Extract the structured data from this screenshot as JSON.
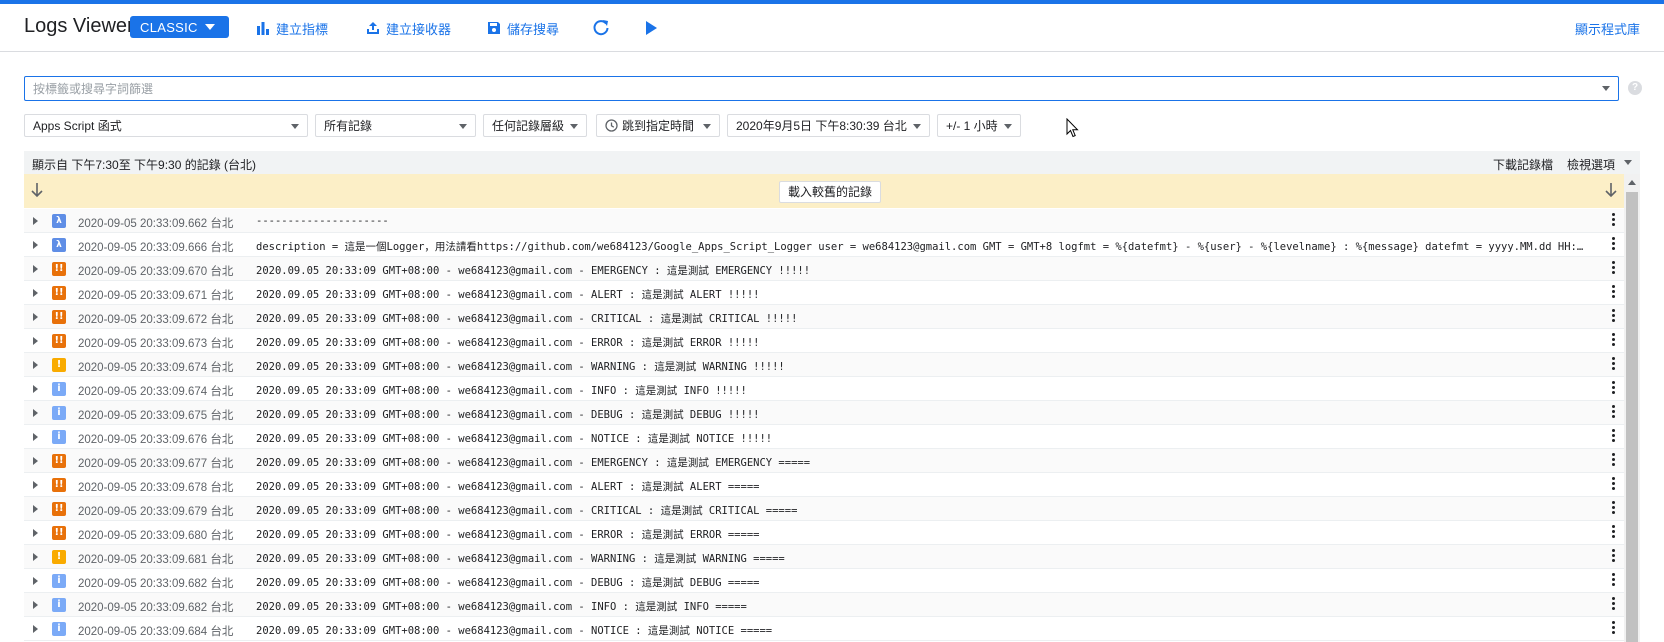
{
  "header": {
    "title": "Logs Viewer",
    "classic_label": "CLASSIC",
    "create_metric": "建立指標",
    "create_sink": "建立接收器",
    "save_search": "儲存搜尋",
    "show_library": "顯示程式庫"
  },
  "filter": {
    "search_placeholder": "按標籤或搜尋字詞篩選",
    "help": "?",
    "resource": "Apps Script 函式",
    "logs": "所有記錄",
    "severity": "任何記錄層級",
    "jump": "跳到指定時間",
    "datetime": "2020年9月5日 下午8:30:39 台北",
    "window": "+/- 1 小時"
  },
  "panel": {
    "range": "顯示自 下午7:30至 下午9:30 的記錄 (台北)",
    "download": "下載記錄檔",
    "view_options": "檢視選項",
    "load_older": "載入較舊的記錄"
  },
  "colors": {
    "accent": "#1a73e8",
    "error": "#e8710a",
    "warning": "#f9ab00",
    "info": "#7baaf7",
    "default": "#5f8ee6",
    "older_bar": "#fcefc7"
  },
  "logs": [
    {
      "sev": "default",
      "icon": "λ",
      "ts": "2020-09-05 20:33:09.662 台北",
      "msg": "---------------------"
    },
    {
      "sev": "default",
      "icon": "λ",
      "ts": "2020-09-05 20:33:09.666 台北",
      "msg": "description = 這是一個Logger，用法請看https://github.com/we684123/Google_Apps_Script_Logger user = we684123@gmail.com GMT = GMT+8 logfmt = %{datefmt} - %{user} - %{levelname} : %{message} datefmt = yyyy.MM.dd HH:mm:ss z…"
    },
    {
      "sev": "error",
      "icon": "!!",
      "ts": "2020-09-05 20:33:09.670 台北",
      "msg": "2020.09.05 20:33:09 GMT+08:00 - we684123@gmail.com - EMERGENCY : 這是測試 EMERGENCY !!!!!"
    },
    {
      "sev": "error",
      "icon": "!!",
      "ts": "2020-09-05 20:33:09.671 台北",
      "msg": "2020.09.05 20:33:09 GMT+08:00 - we684123@gmail.com - ALERT : 這是測試 ALERT !!!!!"
    },
    {
      "sev": "error",
      "icon": "!!",
      "ts": "2020-09-05 20:33:09.672 台北",
      "msg": "2020.09.05 20:33:09 GMT+08:00 - we684123@gmail.com - CRITICAL : 這是測試 CRITICAL !!!!!"
    },
    {
      "sev": "error",
      "icon": "!!",
      "ts": "2020-09-05 20:33:09.673 台北",
      "msg": "2020.09.05 20:33:09 GMT+08:00 - we684123@gmail.com - ERROR : 這是測試 ERROR !!!!!"
    },
    {
      "sev": "warning",
      "icon": "!",
      "ts": "2020-09-05 20:33:09.674 台北",
      "msg": "2020.09.05 20:33:09 GMT+08:00 - we684123@gmail.com - WARNING : 這是測試 WARNING !!!!!"
    },
    {
      "sev": "info",
      "icon": "i",
      "ts": "2020-09-05 20:33:09.674 台北",
      "msg": "2020.09.05 20:33:09 GMT+08:00 - we684123@gmail.com - INFO : 這是測試 INFO !!!!!"
    },
    {
      "sev": "info",
      "icon": "i",
      "ts": "2020-09-05 20:33:09.675 台北",
      "msg": "2020.09.05 20:33:09 GMT+08:00 - we684123@gmail.com - DEBUG : 這是測試 DEBUG !!!!!"
    },
    {
      "sev": "info",
      "icon": "i",
      "ts": "2020-09-05 20:33:09.676 台北",
      "msg": "2020.09.05 20:33:09 GMT+08:00 - we684123@gmail.com - NOTICE : 這是測試 NOTICE !!!!!"
    },
    {
      "sev": "error",
      "icon": "!!",
      "ts": "2020-09-05 20:33:09.677 台北",
      "msg": "2020.09.05 20:33:09 GMT+08:00 - we684123@gmail.com - EMERGENCY : 這是測試 EMERGENCY ====="
    },
    {
      "sev": "error",
      "icon": "!!",
      "ts": "2020-09-05 20:33:09.678 台北",
      "msg": "2020.09.05 20:33:09 GMT+08:00 - we684123@gmail.com - ALERT : 這是測試 ALERT ====="
    },
    {
      "sev": "error",
      "icon": "!!",
      "ts": "2020-09-05 20:33:09.679 台北",
      "msg": "2020.09.05 20:33:09 GMT+08:00 - we684123@gmail.com - CRITICAL : 這是測試 CRITICAL ====="
    },
    {
      "sev": "error",
      "icon": "!!",
      "ts": "2020-09-05 20:33:09.680 台北",
      "msg": "2020.09.05 20:33:09 GMT+08:00 - we684123@gmail.com - ERROR : 這是測試 ERROR ====="
    },
    {
      "sev": "warning",
      "icon": "!",
      "ts": "2020-09-05 20:33:09.681 台北",
      "msg": "2020.09.05 20:33:09 GMT+08:00 - we684123@gmail.com - WARNING : 這是測試 WARNING ====="
    },
    {
      "sev": "info",
      "icon": "i",
      "ts": "2020-09-05 20:33:09.682 台北",
      "msg": "2020.09.05 20:33:09 GMT+08:00 - we684123@gmail.com - DEBUG : 這是測試 DEBUG ====="
    },
    {
      "sev": "info",
      "icon": "i",
      "ts": "2020-09-05 20:33:09.682 台北",
      "msg": "2020.09.05 20:33:09 GMT+08:00 - we684123@gmail.com - INFO : 這是測試 INFO ====="
    },
    {
      "sev": "info",
      "icon": "i",
      "ts": "2020-09-05 20:33:09.684 台北",
      "msg": "2020.09.05 20:33:09 GMT+08:00 - we684123@gmail.com - NOTICE : 這是測試 NOTICE ====="
    }
  ]
}
